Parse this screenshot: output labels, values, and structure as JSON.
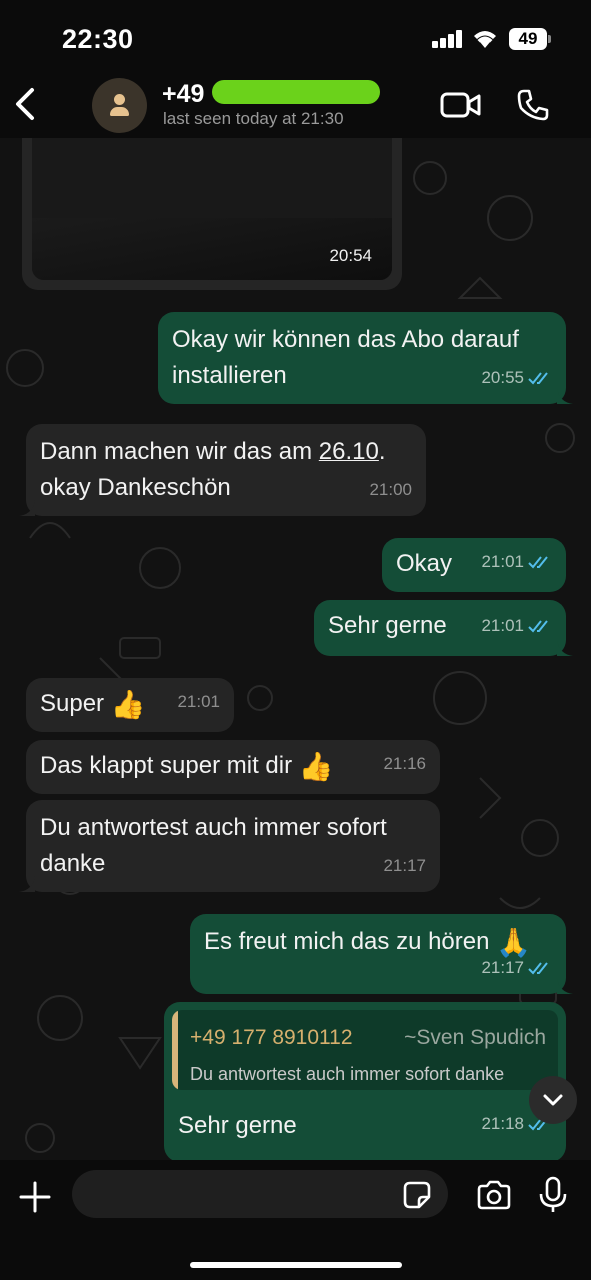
{
  "status_bar": {
    "time": "22:30",
    "battery": "49"
  },
  "header": {
    "contact_prefix": "+49",
    "last_seen": "last seen today at 21:30"
  },
  "messages": [
    {
      "type": "image",
      "time": "20:54"
    },
    {
      "dir": "out",
      "text": "Okay wir können das Abo darauf installieren",
      "time": "20:55",
      "read": true
    },
    {
      "dir": "in",
      "text_a": "Dann machen wir das am ",
      "text_link": "26.10",
      "text_b": ".",
      "text_c": "okay Dankeschön",
      "time": "21:00"
    },
    {
      "dir": "out",
      "text": "Okay",
      "time": "21:01",
      "read": true
    },
    {
      "dir": "out",
      "text": "Sehr gerne",
      "time": "21:01",
      "read": true
    },
    {
      "dir": "in",
      "text": "Super",
      "emoji": "👍",
      "time": "21:01"
    },
    {
      "dir": "in",
      "text": "Das klappt super mit dir",
      "emoji": "👍",
      "time": "21:16"
    },
    {
      "dir": "in",
      "text_line1": "Du antwortest auch immer sofort",
      "text_line2": "danke",
      "time": "21:17"
    },
    {
      "dir": "out",
      "text": "Es freut mich das zu hören",
      "emoji": "🙏",
      "time": "21:17",
      "read": true
    },
    {
      "dir": "out",
      "reply": {
        "number": "+49 177 8910112",
        "sender": "~Sven Spudich",
        "quoted": "Du antwortest auch immer sofort danke"
      },
      "text": "Sehr gerne",
      "time": "21:18",
      "read": true
    }
  ],
  "composer": {
    "placeholder": ""
  },
  "colors": {
    "incoming": "#252525",
    "outgoing": "#144d37",
    "read_ticks": "#53bdeb",
    "reply_accent": "#d7b67a",
    "redaction": "#6bd21b"
  },
  "icons": [
    "back-chevron-icon",
    "avatar-person-icon",
    "video-call-icon",
    "phone-icon",
    "plus-icon",
    "sticker-icon",
    "camera-icon",
    "microphone-icon",
    "chevron-down-icon"
  ]
}
